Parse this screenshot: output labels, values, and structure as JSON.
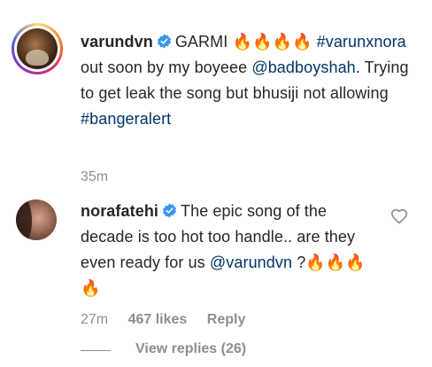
{
  "comments": [
    {
      "username": "varundvn",
      "text_parts": {
        "p1": "GARMI ",
        "p1_emoji": "🔥🔥🔥🔥",
        "p2_tag": "#varunxnora",
        "p3": " out soon by my boyeee ",
        "p4_mention": "@badboyshah",
        "p5": ". Trying to get leak the song but bhusiji not allowing ",
        "p6_tag": "#bangeralert"
      },
      "time": "35m",
      "verified": true
    },
    {
      "username": "norafatehi",
      "text_parts": {
        "p1": "The epic song of the decade is too hot too handle.. are they even ready for us ",
        "p2_mention": "@varundvn",
        "p3": " ?",
        "p3_emoji": "🔥🔥🔥🔥"
      },
      "time": "27m",
      "likes": "467 likes",
      "reply": "Reply",
      "view_replies": "View replies (26)",
      "verified": true
    }
  ],
  "colors": {
    "text": "#262626",
    "link": "#003569",
    "meta": "#8e8e8e",
    "verified": "#3897f0"
  },
  "icons": {
    "verified": "verified-badge-icon",
    "like": "heart-outline-icon"
  }
}
